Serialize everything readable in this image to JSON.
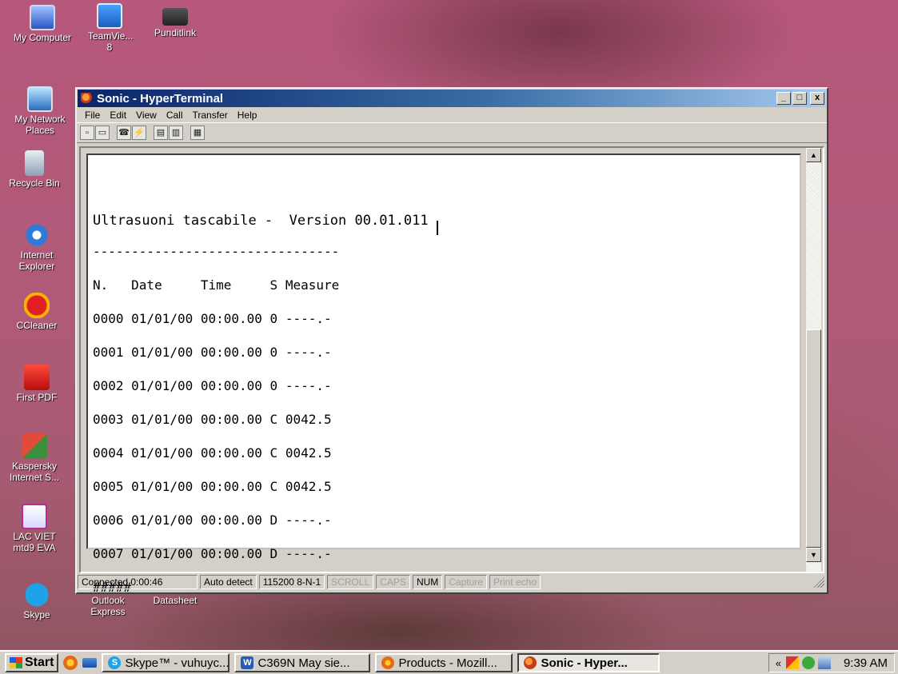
{
  "desktop": {
    "icons": [
      {
        "label": "My Computer"
      },
      {
        "label": "My Network Places"
      },
      {
        "label": "Recycle Bin"
      },
      {
        "label": "Internet Explorer"
      },
      {
        "label": "CCleaner"
      },
      {
        "label": "First PDF"
      },
      {
        "label": "Kaspersky Internet S..."
      },
      {
        "label": "LAC VIET mtd9 EVA"
      },
      {
        "label": "Skype"
      },
      {
        "label": "TeamVie... 8"
      },
      {
        "label": "Punditlink"
      },
      {
        "label": "Outlook Express"
      },
      {
        "label": "Datasheet"
      }
    ]
  },
  "window": {
    "title": "Sonic - HyperTerminal",
    "controls": {
      "minimize": "_",
      "maximize": "□",
      "close": "x"
    },
    "menu": [
      "File",
      "Edit",
      "View",
      "Call",
      "Transfer",
      "Help"
    ],
    "toolbar_icons": [
      "new-icon",
      "open-icon",
      "connect-icon",
      "disconnect-icon",
      "send-icon",
      "receive-icon",
      "properties-icon"
    ],
    "terminal": {
      "title_line": "Ultrasuoni tascabile -  Version 00.01.011",
      "rule_line": "--------------------------------",
      "header_line": "N.   Date     Time     S Measure",
      "rows": [
        "0000 01/01/00 00:00.00 0 ----.-",
        "0001 01/01/00 00:00.00 0 ----.-",
        "0002 01/01/00 00:00.00 0 ----.-",
        "0003 01/01/00 00:00.00 C 0042.5",
        "0004 01/01/00 00:00.00 C 0042.5",
        "0005 01/01/00 00:00.00 C 0042.5",
        "0006 01/01/00 00:00.00 D ----.-",
        "0007 01/01/00 00:00.00 D ----.-"
      ],
      "end_line": "#####"
    },
    "statusbar": {
      "connected": "Connected 0:00:46",
      "detect": "Auto detect",
      "port": "115200 8-N-1",
      "scroll": "SCROLL",
      "caps": "CAPS",
      "num": "NUM",
      "capture": "Capture",
      "print_echo": "Print echo"
    }
  },
  "taskbar": {
    "start": "Start",
    "tasks": [
      {
        "label": "Skype™ - vuhuyc..."
      },
      {
        "label": "C369N  May sie..."
      },
      {
        "label": "Products - Mozill..."
      },
      {
        "label": "Sonic - Hyper..."
      }
    ],
    "tray_chevron": "«",
    "clock": "9:39 AM"
  }
}
